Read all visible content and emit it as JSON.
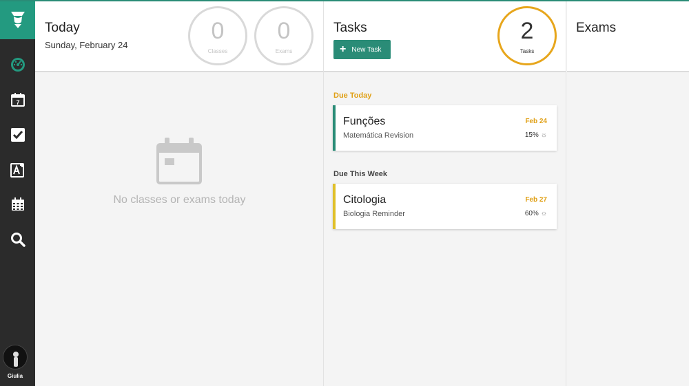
{
  "sidebar": {
    "items": [
      {
        "name": "dashboard",
        "icon": "dashboard-gauge-icon",
        "active": true
      },
      {
        "name": "calendar",
        "icon": "calendar-day-icon",
        "day": "7"
      },
      {
        "name": "tasks",
        "icon": "checkbox-icon"
      },
      {
        "name": "exams",
        "icon": "exam-icon"
      },
      {
        "name": "schedule",
        "icon": "schedule-grid-icon"
      },
      {
        "name": "search",
        "icon": "search-icon"
      }
    ],
    "user": {
      "name": "Giulia"
    }
  },
  "today": {
    "title": "Today",
    "date": "Sunday, February 24",
    "classes": {
      "count": "0",
      "label": "Classes"
    },
    "exams": {
      "count": "0",
      "label": "Exams"
    },
    "empty_message": "No classes or exams today"
  },
  "tasks": {
    "title": "Tasks",
    "new_task_label": "New Task",
    "count": {
      "value": "2",
      "label": "Tasks"
    },
    "sections": [
      {
        "label": "Due Today",
        "color": "#e0a016",
        "items": [
          {
            "title": "Funções",
            "subject": "Matemática Revision",
            "date": "Feb 24",
            "progress": "15%",
            "accent": "#2a8c77"
          }
        ]
      },
      {
        "label": "Due This Week",
        "color": "#444444",
        "items": [
          {
            "title": "Citologia",
            "subject": "Biologia Reminder",
            "date": "Feb 27",
            "progress": "60%",
            "accent": "#e0c02a"
          }
        ]
      }
    ]
  },
  "exams": {
    "title": "Exams"
  },
  "colors": {
    "brand": "#2a8c77",
    "accent": "#e7a61c",
    "sidebar": "#2b2b2b"
  }
}
